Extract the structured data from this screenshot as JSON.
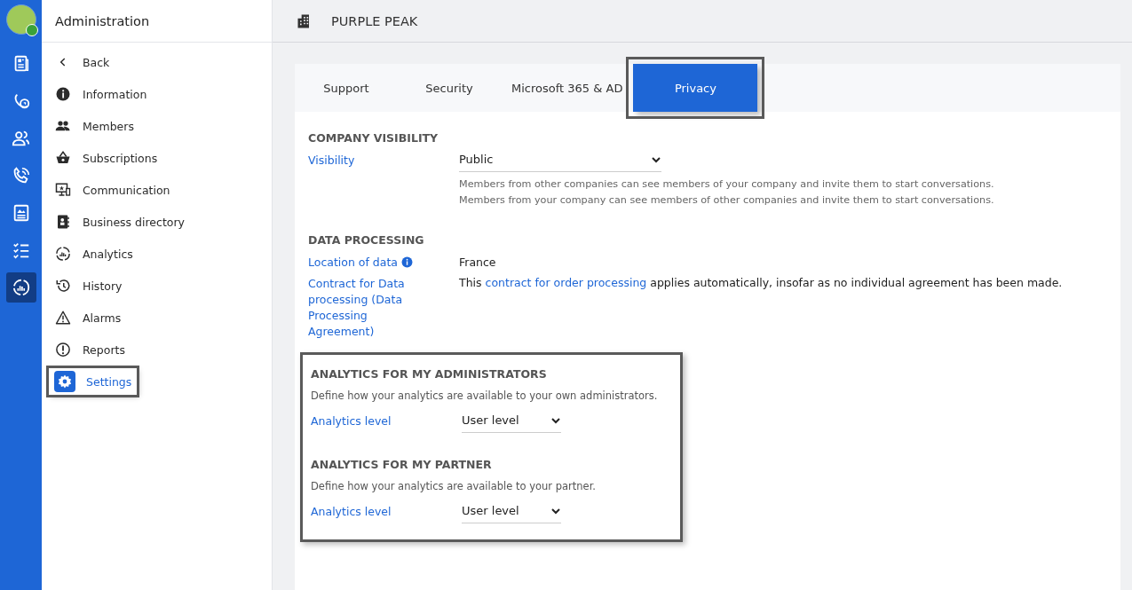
{
  "rail": {
    "items": [
      {
        "kind": "news",
        "selected": false
      },
      {
        "kind": "calls",
        "selected": false
      },
      {
        "kind": "contacts",
        "selected": false
      },
      {
        "kind": "phone",
        "selected": false
      },
      {
        "kind": "document",
        "selected": false
      },
      {
        "kind": "tasks",
        "selected": false
      },
      {
        "kind": "analytics",
        "selected": true
      }
    ]
  },
  "nav": {
    "title": "Administration",
    "back": "Back",
    "items": [
      {
        "kind": "info",
        "label": "Information",
        "selected": false,
        "highlighted": false
      },
      {
        "kind": "members",
        "label": "Members",
        "selected": false,
        "highlighted": false
      },
      {
        "kind": "basket",
        "label": "Subscriptions",
        "selected": false,
        "highlighted": false
      },
      {
        "kind": "screen",
        "label": "Communication",
        "selected": false,
        "highlighted": false
      },
      {
        "kind": "book",
        "label": "Business directory",
        "selected": false,
        "highlighted": false
      },
      {
        "kind": "analytics",
        "label": "Analytics",
        "selected": false,
        "highlighted": false
      },
      {
        "kind": "history",
        "label": "History",
        "selected": false,
        "highlighted": false
      },
      {
        "kind": "warning",
        "label": "Alarms",
        "selected": false,
        "highlighted": false
      },
      {
        "kind": "alert",
        "label": "Reports",
        "selected": false,
        "highlighted": false
      },
      {
        "kind": "gear",
        "label": "Settings",
        "selected": true,
        "highlighted": true
      }
    ]
  },
  "header": {
    "title": "PURPLE PEAK"
  },
  "tabs": [
    {
      "label": "Support",
      "selected": false,
      "highlighted": false
    },
    {
      "label": "Security",
      "selected": false,
      "highlighted": false
    },
    {
      "label": "Microsoft 365 & AD",
      "selected": false,
      "highlighted": false
    },
    {
      "label": "Privacy",
      "selected": true,
      "highlighted": true
    }
  ],
  "company_visibility": {
    "heading": "COMPANY VISIBILITY",
    "label": "Visibility",
    "value": "Public",
    "notes": [
      "Members from other companies can see members of your company and invite them to start conversations.",
      "Members from your company can see members of other companies and invite them to start conversations."
    ]
  },
  "data_processing": {
    "heading": "DATA PROCESSING",
    "location_label": "Location of data",
    "location_value": "France",
    "contract_label": "Contract for Data processing (Data Processing Agreement)",
    "contract_before": "This ",
    "contract_link": "contract for order processing",
    "contract_after": " applies automatically, insofar as no individual agreement has been made."
  },
  "analytics_highlighted": true,
  "analytics_sections": [
    {
      "heading": "ANALYTICS FOR MY ADMINISTRATORS",
      "description": "Define how your analytics are available to your own administrators.",
      "label": "Analytics level",
      "value": "User level"
    },
    {
      "heading": "ANALYTICS FOR MY PARTNER",
      "description": "Define how your analytics are available to your partner.",
      "label": "Analytics level",
      "value": "User level"
    }
  ]
}
